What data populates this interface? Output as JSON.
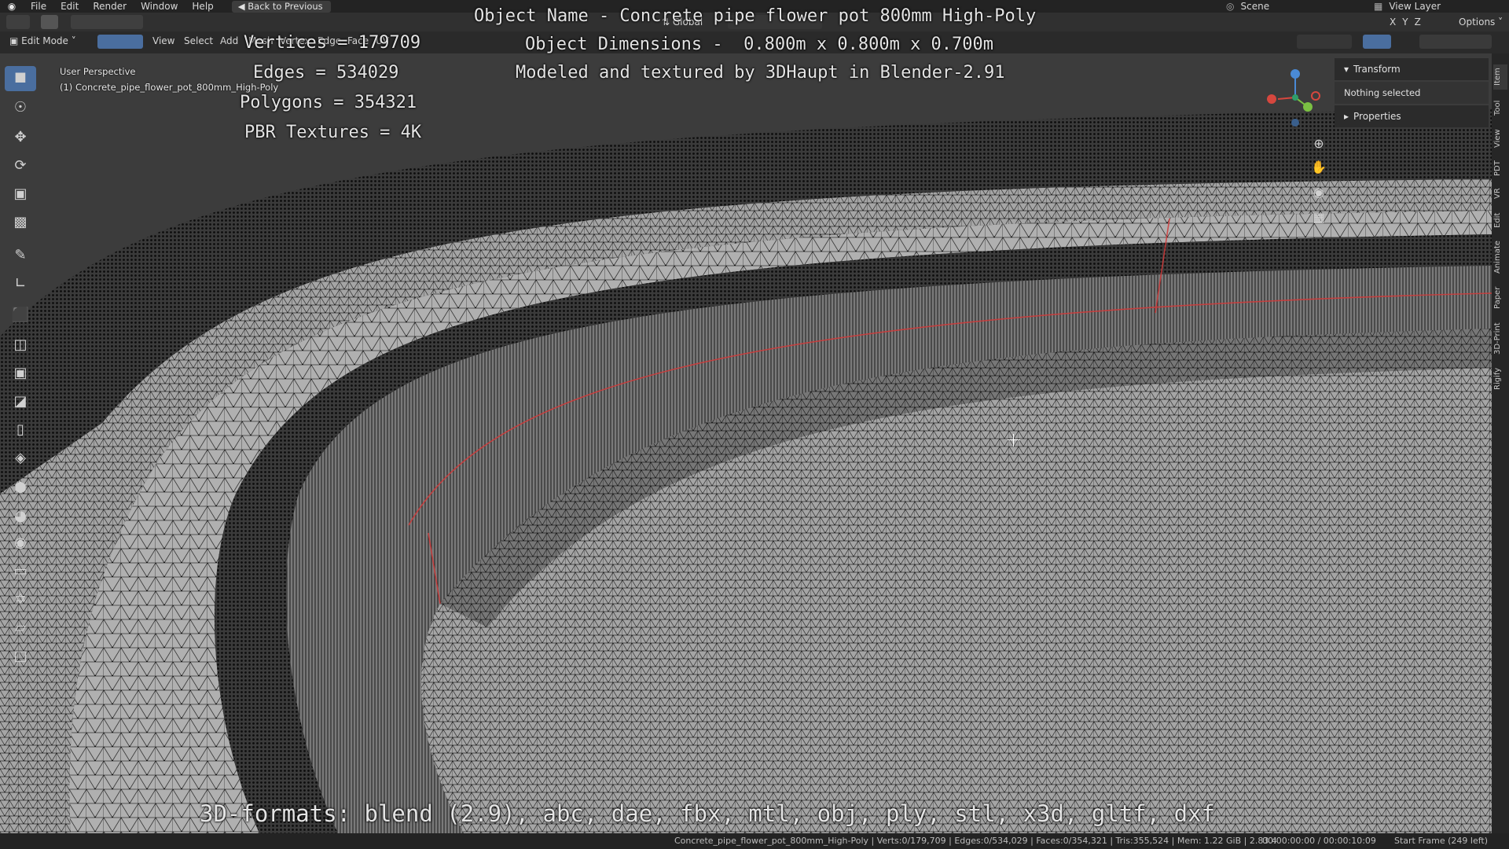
{
  "menubar": {
    "items": [
      "File",
      "Edit",
      "Render",
      "Window",
      "Help"
    ],
    "back_button": "Back to Previous",
    "scene": "Scene",
    "view_layer": "View Layer"
  },
  "header": {
    "mode": "Edit Mode",
    "menus": [
      "View",
      "Select",
      "Add",
      "Mesh",
      "Vertex",
      "Edge",
      "Face",
      "UV"
    ],
    "transform_orientation": "Global",
    "options": "Options",
    "axes": [
      "X",
      "Y",
      "Z"
    ]
  },
  "viewport": {
    "perspective": "User Perspective",
    "object_label": "(1) Concrete_pipe_flower_pot_800mm_High-Poly"
  },
  "overlay": {
    "object_name": "Object Name - Concrete pipe flower pot 800mm High-Poly",
    "dimensions": "Object Dimensions -  0.800m x 0.800m x 0.700m",
    "credit": "Modeled and textured by 3DHaupt in Blender-2.91",
    "vertices": "Vertices = 179709",
    "edges": "Edges = 534029",
    "polygons": "Polygons = 354321",
    "textures": "PBR Textures = 4K",
    "formats": "3D-formats: blend (2.9), abc, dae, fbx, mtl, obj, ply, stl, x3d, gltf, dxf"
  },
  "sidebar": {
    "transform": "Transform",
    "nothing_selected": "Nothing selected",
    "properties": "Properties",
    "tabs": [
      "Item",
      "Tool",
      "View",
      "PDT",
      "VR",
      "Edit",
      "Animate",
      "Paper",
      "3D-Print",
      "Rigify"
    ]
  },
  "statusbar": {
    "stats": "Concrete_pipe_flower_pot_800mm_High-Poly | Verts:0/179,709 | Edges:0/534,029 | Faces:0/354,321 | Tris:355,524 | Mem: 1.22 GiB | 2.83.4",
    "time": "00:00:00:00 / 00:00:10:09",
    "frame": "Start Frame (249 left)"
  },
  "colors": {
    "accent": "#4a6e9f",
    "seam": "#d23a3a",
    "mesh_face": "#a9a9a9",
    "wire": "#000000"
  }
}
